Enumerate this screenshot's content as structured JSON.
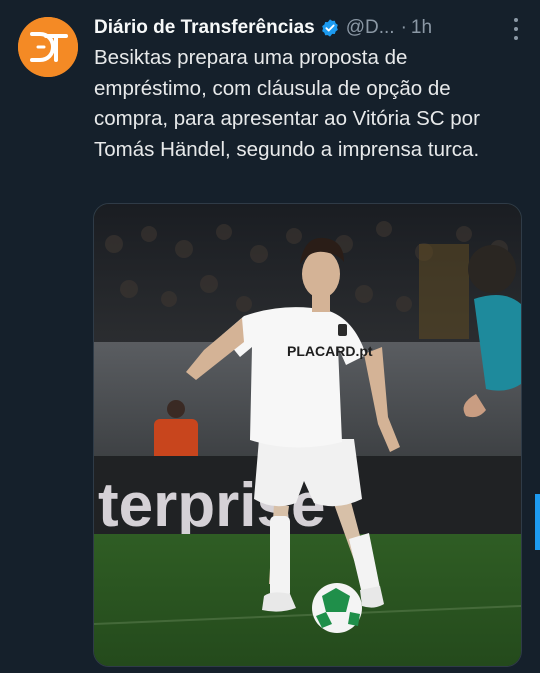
{
  "tweet": {
    "author_name": "Diário de Transferências",
    "author_handle": "@D...",
    "separator": "·",
    "time": "1h",
    "text": "Besiktas prepara uma proposta de empréstimo, com cláusula de opção de compra, para apresentar ao Vitória SC por Tomás Händel, segundo a imprensa turca.",
    "verified": true
  },
  "avatar": {
    "bg_color": "#f48a25",
    "icon": "dt-logo-icon"
  },
  "media": {
    "board_text": "terprise",
    "shirt_sponsor": "PLACARD.pt",
    "description_icon": "football-player-photo"
  },
  "colors": {
    "background": "#15202b",
    "text": "#e7e9ea",
    "muted": "#8b98a5",
    "verified": "#1d9bf0"
  }
}
